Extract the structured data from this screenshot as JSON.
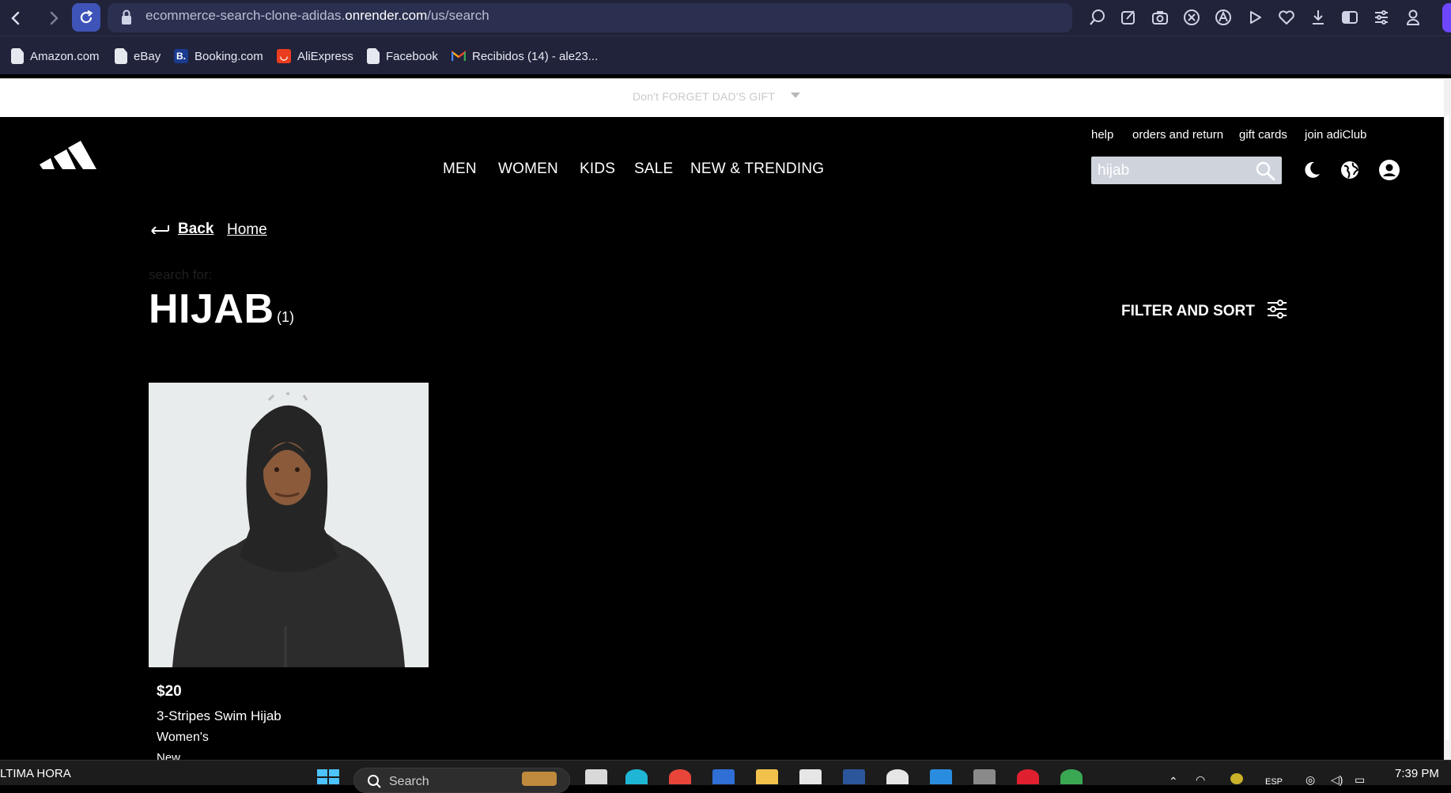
{
  "browser": {
    "url_prefix": "ecommerce-search-clone-adidas.",
    "url_domain": "onrender.com",
    "url_path": "/us/search",
    "bookmarks": [
      {
        "label": "Amazon.com",
        "icon": "document-icon"
      },
      {
        "label": "eBay",
        "icon": "document-icon"
      },
      {
        "label": "Booking.com",
        "icon": "booking-icon"
      },
      {
        "label": "AliExpress",
        "icon": "aliexpress-icon"
      },
      {
        "label": "Facebook",
        "icon": "document-icon"
      },
      {
        "label": "Recibidos (14) - ale23...",
        "icon": "gmail-icon"
      }
    ]
  },
  "announcement": {
    "text": "Don't FORGET DAD'S GIFT"
  },
  "header": {
    "top_links": [
      "help",
      "orders and return",
      "gift cards",
      "join adiClub"
    ],
    "nav": [
      "MEN",
      "WOMEN",
      "KIDS",
      "SALE",
      "NEW & TRENDING"
    ],
    "search_value": "hijab"
  },
  "breadcrumb": {
    "back": "Back",
    "home": "Home"
  },
  "results": {
    "search_for_label": "search for:",
    "query": "HIJAB",
    "count": "(1)",
    "filter_label": "FILTER AND SORT"
  },
  "products": [
    {
      "price": "$20",
      "name": "3-Stripes Swim Hijab",
      "gender": "Women's",
      "badge": "New"
    }
  ],
  "taskbar": {
    "news": "LTIMA HORA",
    "search_placeholder": "Search",
    "language": "ESP",
    "time": "7:39 PM"
  },
  "colors": {
    "chrome_bg": "#20233a",
    "page_bg": "#000000",
    "accent_reload": "#3f54b8",
    "product_bg": "#e9ecec"
  }
}
